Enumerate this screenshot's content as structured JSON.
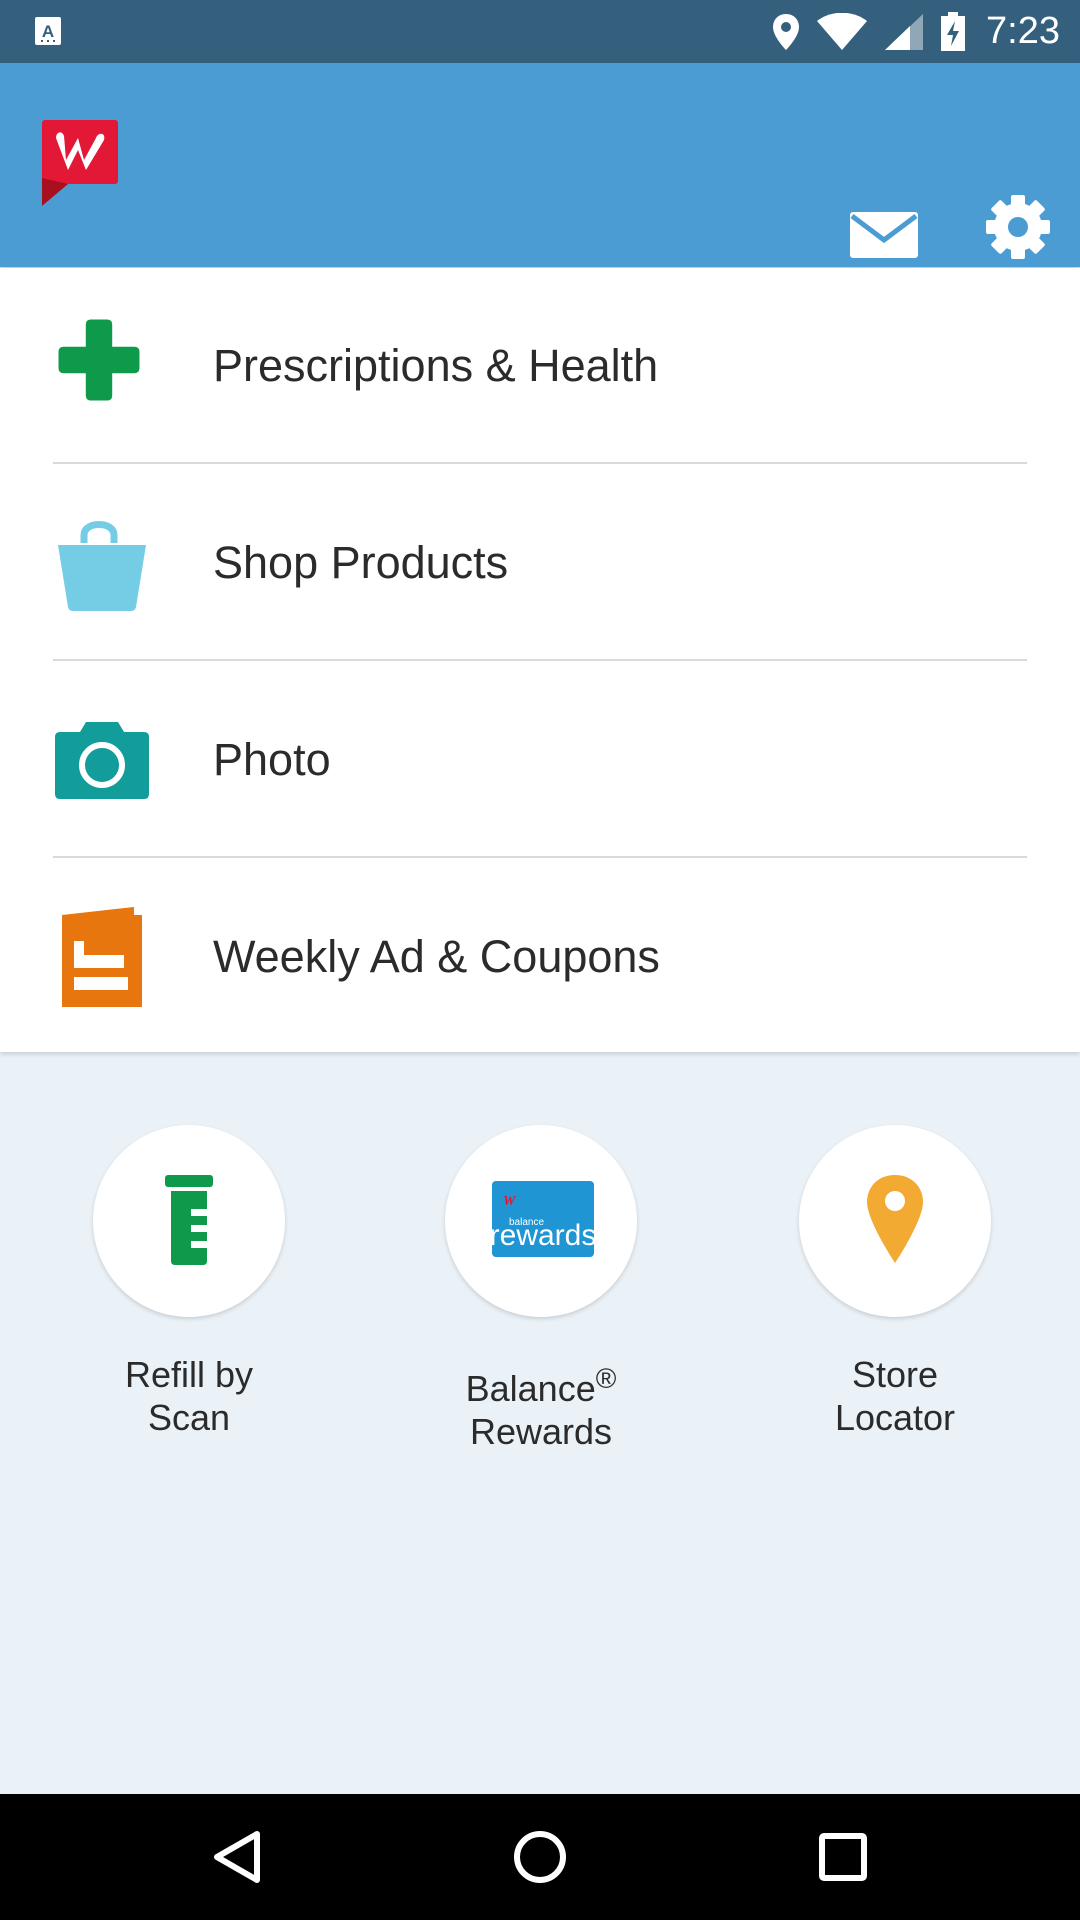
{
  "status_bar": {
    "time": "7:23",
    "icons": [
      "keyboard-a-icon",
      "location-icon",
      "wifi-icon",
      "signal-icon",
      "battery-charging-icon"
    ]
  },
  "app_bar": {
    "logo": "walgreens-logo",
    "actions": [
      "mail-icon",
      "gear-icon"
    ],
    "brand_color": "#4b9cd3"
  },
  "menu": {
    "items": [
      {
        "label": "Prescriptions & Health",
        "icon": "medical-cross-icon",
        "color": "#0e9a4a"
      },
      {
        "label": "Shop Products",
        "icon": "shopping-bag-icon",
        "color": "#74cde5"
      },
      {
        "label": "Photo",
        "icon": "camera-icon",
        "color": "#129c9a"
      },
      {
        "label": "Weekly Ad & Coupons",
        "icon": "weekly-ad-icon",
        "color": "#e8760f"
      }
    ]
  },
  "shortcuts": {
    "items": [
      {
        "line1": "Refill by",
        "line2": "Scan",
        "icon": "pill-bottle-icon",
        "color": "#0e9a4a"
      },
      {
        "line1": "Balance",
        "sup": "®",
        "line2": "Rewards",
        "icon": "balance-rewards-icon",
        "color": "#1f95d4",
        "badge_small": "balance",
        "badge_big": "rewards"
      },
      {
        "line1": "Store",
        "line2": "Locator",
        "icon": "map-pin-icon",
        "color": "#f2aa33"
      }
    ]
  },
  "nav_bar": {
    "buttons": [
      "back-icon",
      "home-icon",
      "recents-icon"
    ]
  }
}
